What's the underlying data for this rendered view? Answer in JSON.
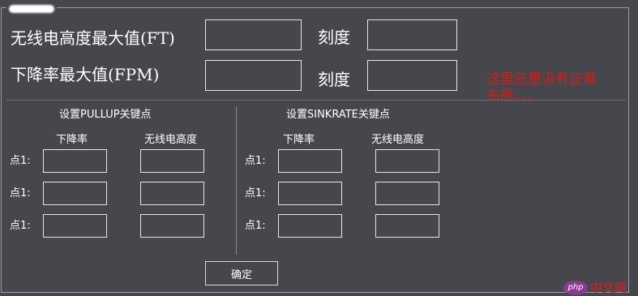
{
  "top": {
    "radio_alt_max_label": "无线电高度最大值(FT)",
    "radio_alt_max_value": "",
    "scale_label_1": "刻度",
    "scale_value_1": "",
    "descent_max_label": "下降率最大值(FPM)",
    "descent_max_value": "",
    "scale_label_2": "刻度",
    "scale_value_2": ""
  },
  "note": {
    "line1": "这里还是没有正常",
    "line2": "布局。。。"
  },
  "pullup": {
    "title": "设置PULLUP关键点",
    "col_descent": "下降率",
    "col_alt": "无线电高度",
    "rows": [
      {
        "label": "点1:",
        "descent": "",
        "alt": ""
      },
      {
        "label": "点1:",
        "descent": "",
        "alt": ""
      },
      {
        "label": "点1:",
        "descent": "",
        "alt": ""
      }
    ]
  },
  "sinkrate": {
    "title": "设置SINKRATE关键点",
    "col_descent": "下降率",
    "col_alt": "无线电高度",
    "rows": [
      {
        "label": "点1:",
        "descent": "",
        "alt": ""
      },
      {
        "label": "点1:",
        "descent": "",
        "alt": ""
      },
      {
        "label": "点1:",
        "descent": "",
        "alt": ""
      }
    ]
  },
  "buttons": {
    "ok": "确定"
  },
  "watermark": {
    "logo": "php",
    "text": "中文网"
  },
  "colors": {
    "background": "#45474c",
    "note": "#d21e1e",
    "field_border": "#e6e6e6"
  }
}
